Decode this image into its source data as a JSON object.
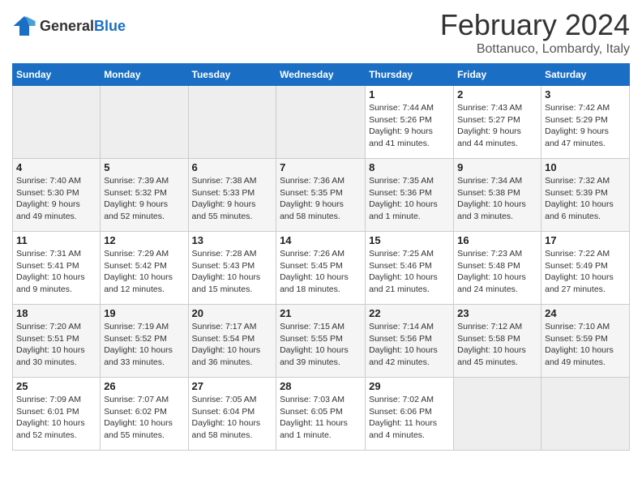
{
  "logo": {
    "text_general": "General",
    "text_blue": "Blue"
  },
  "title": "February 2024",
  "location": "Bottanuco, Lombardy, Italy",
  "weekdays": [
    "Sunday",
    "Monday",
    "Tuesday",
    "Wednesday",
    "Thursday",
    "Friday",
    "Saturday"
  ],
  "weeks": [
    [
      {
        "day": "",
        "info": ""
      },
      {
        "day": "",
        "info": ""
      },
      {
        "day": "",
        "info": ""
      },
      {
        "day": "",
        "info": ""
      },
      {
        "day": "1",
        "info": "Sunrise: 7:44 AM\nSunset: 5:26 PM\nDaylight: 9 hours\nand 41 minutes."
      },
      {
        "day": "2",
        "info": "Sunrise: 7:43 AM\nSunset: 5:27 PM\nDaylight: 9 hours\nand 44 minutes."
      },
      {
        "day": "3",
        "info": "Sunrise: 7:42 AM\nSunset: 5:29 PM\nDaylight: 9 hours\nand 47 minutes."
      }
    ],
    [
      {
        "day": "4",
        "info": "Sunrise: 7:40 AM\nSunset: 5:30 PM\nDaylight: 9 hours\nand 49 minutes."
      },
      {
        "day": "5",
        "info": "Sunrise: 7:39 AM\nSunset: 5:32 PM\nDaylight: 9 hours\nand 52 minutes."
      },
      {
        "day": "6",
        "info": "Sunrise: 7:38 AM\nSunset: 5:33 PM\nDaylight: 9 hours\nand 55 minutes."
      },
      {
        "day": "7",
        "info": "Sunrise: 7:36 AM\nSunset: 5:35 PM\nDaylight: 9 hours\nand 58 minutes."
      },
      {
        "day": "8",
        "info": "Sunrise: 7:35 AM\nSunset: 5:36 PM\nDaylight: 10 hours\nand 1 minute."
      },
      {
        "day": "9",
        "info": "Sunrise: 7:34 AM\nSunset: 5:38 PM\nDaylight: 10 hours\nand 3 minutes."
      },
      {
        "day": "10",
        "info": "Sunrise: 7:32 AM\nSunset: 5:39 PM\nDaylight: 10 hours\nand 6 minutes."
      }
    ],
    [
      {
        "day": "11",
        "info": "Sunrise: 7:31 AM\nSunset: 5:41 PM\nDaylight: 10 hours\nand 9 minutes."
      },
      {
        "day": "12",
        "info": "Sunrise: 7:29 AM\nSunset: 5:42 PM\nDaylight: 10 hours\nand 12 minutes."
      },
      {
        "day": "13",
        "info": "Sunrise: 7:28 AM\nSunset: 5:43 PM\nDaylight: 10 hours\nand 15 minutes."
      },
      {
        "day": "14",
        "info": "Sunrise: 7:26 AM\nSunset: 5:45 PM\nDaylight: 10 hours\nand 18 minutes."
      },
      {
        "day": "15",
        "info": "Sunrise: 7:25 AM\nSunset: 5:46 PM\nDaylight: 10 hours\nand 21 minutes."
      },
      {
        "day": "16",
        "info": "Sunrise: 7:23 AM\nSunset: 5:48 PM\nDaylight: 10 hours\nand 24 minutes."
      },
      {
        "day": "17",
        "info": "Sunrise: 7:22 AM\nSunset: 5:49 PM\nDaylight: 10 hours\nand 27 minutes."
      }
    ],
    [
      {
        "day": "18",
        "info": "Sunrise: 7:20 AM\nSunset: 5:51 PM\nDaylight: 10 hours\nand 30 minutes."
      },
      {
        "day": "19",
        "info": "Sunrise: 7:19 AM\nSunset: 5:52 PM\nDaylight: 10 hours\nand 33 minutes."
      },
      {
        "day": "20",
        "info": "Sunrise: 7:17 AM\nSunset: 5:54 PM\nDaylight: 10 hours\nand 36 minutes."
      },
      {
        "day": "21",
        "info": "Sunrise: 7:15 AM\nSunset: 5:55 PM\nDaylight: 10 hours\nand 39 minutes."
      },
      {
        "day": "22",
        "info": "Sunrise: 7:14 AM\nSunset: 5:56 PM\nDaylight: 10 hours\nand 42 minutes."
      },
      {
        "day": "23",
        "info": "Sunrise: 7:12 AM\nSunset: 5:58 PM\nDaylight: 10 hours\nand 45 minutes."
      },
      {
        "day": "24",
        "info": "Sunrise: 7:10 AM\nSunset: 5:59 PM\nDaylight: 10 hours\nand 49 minutes."
      }
    ],
    [
      {
        "day": "25",
        "info": "Sunrise: 7:09 AM\nSunset: 6:01 PM\nDaylight: 10 hours\nand 52 minutes."
      },
      {
        "day": "26",
        "info": "Sunrise: 7:07 AM\nSunset: 6:02 PM\nDaylight: 10 hours\nand 55 minutes."
      },
      {
        "day": "27",
        "info": "Sunrise: 7:05 AM\nSunset: 6:04 PM\nDaylight: 10 hours\nand 58 minutes."
      },
      {
        "day": "28",
        "info": "Sunrise: 7:03 AM\nSunset: 6:05 PM\nDaylight: 11 hours\nand 1 minute."
      },
      {
        "day": "29",
        "info": "Sunrise: 7:02 AM\nSunset: 6:06 PM\nDaylight: 11 hours\nand 4 minutes."
      },
      {
        "day": "",
        "info": ""
      },
      {
        "day": "",
        "info": ""
      }
    ]
  ]
}
